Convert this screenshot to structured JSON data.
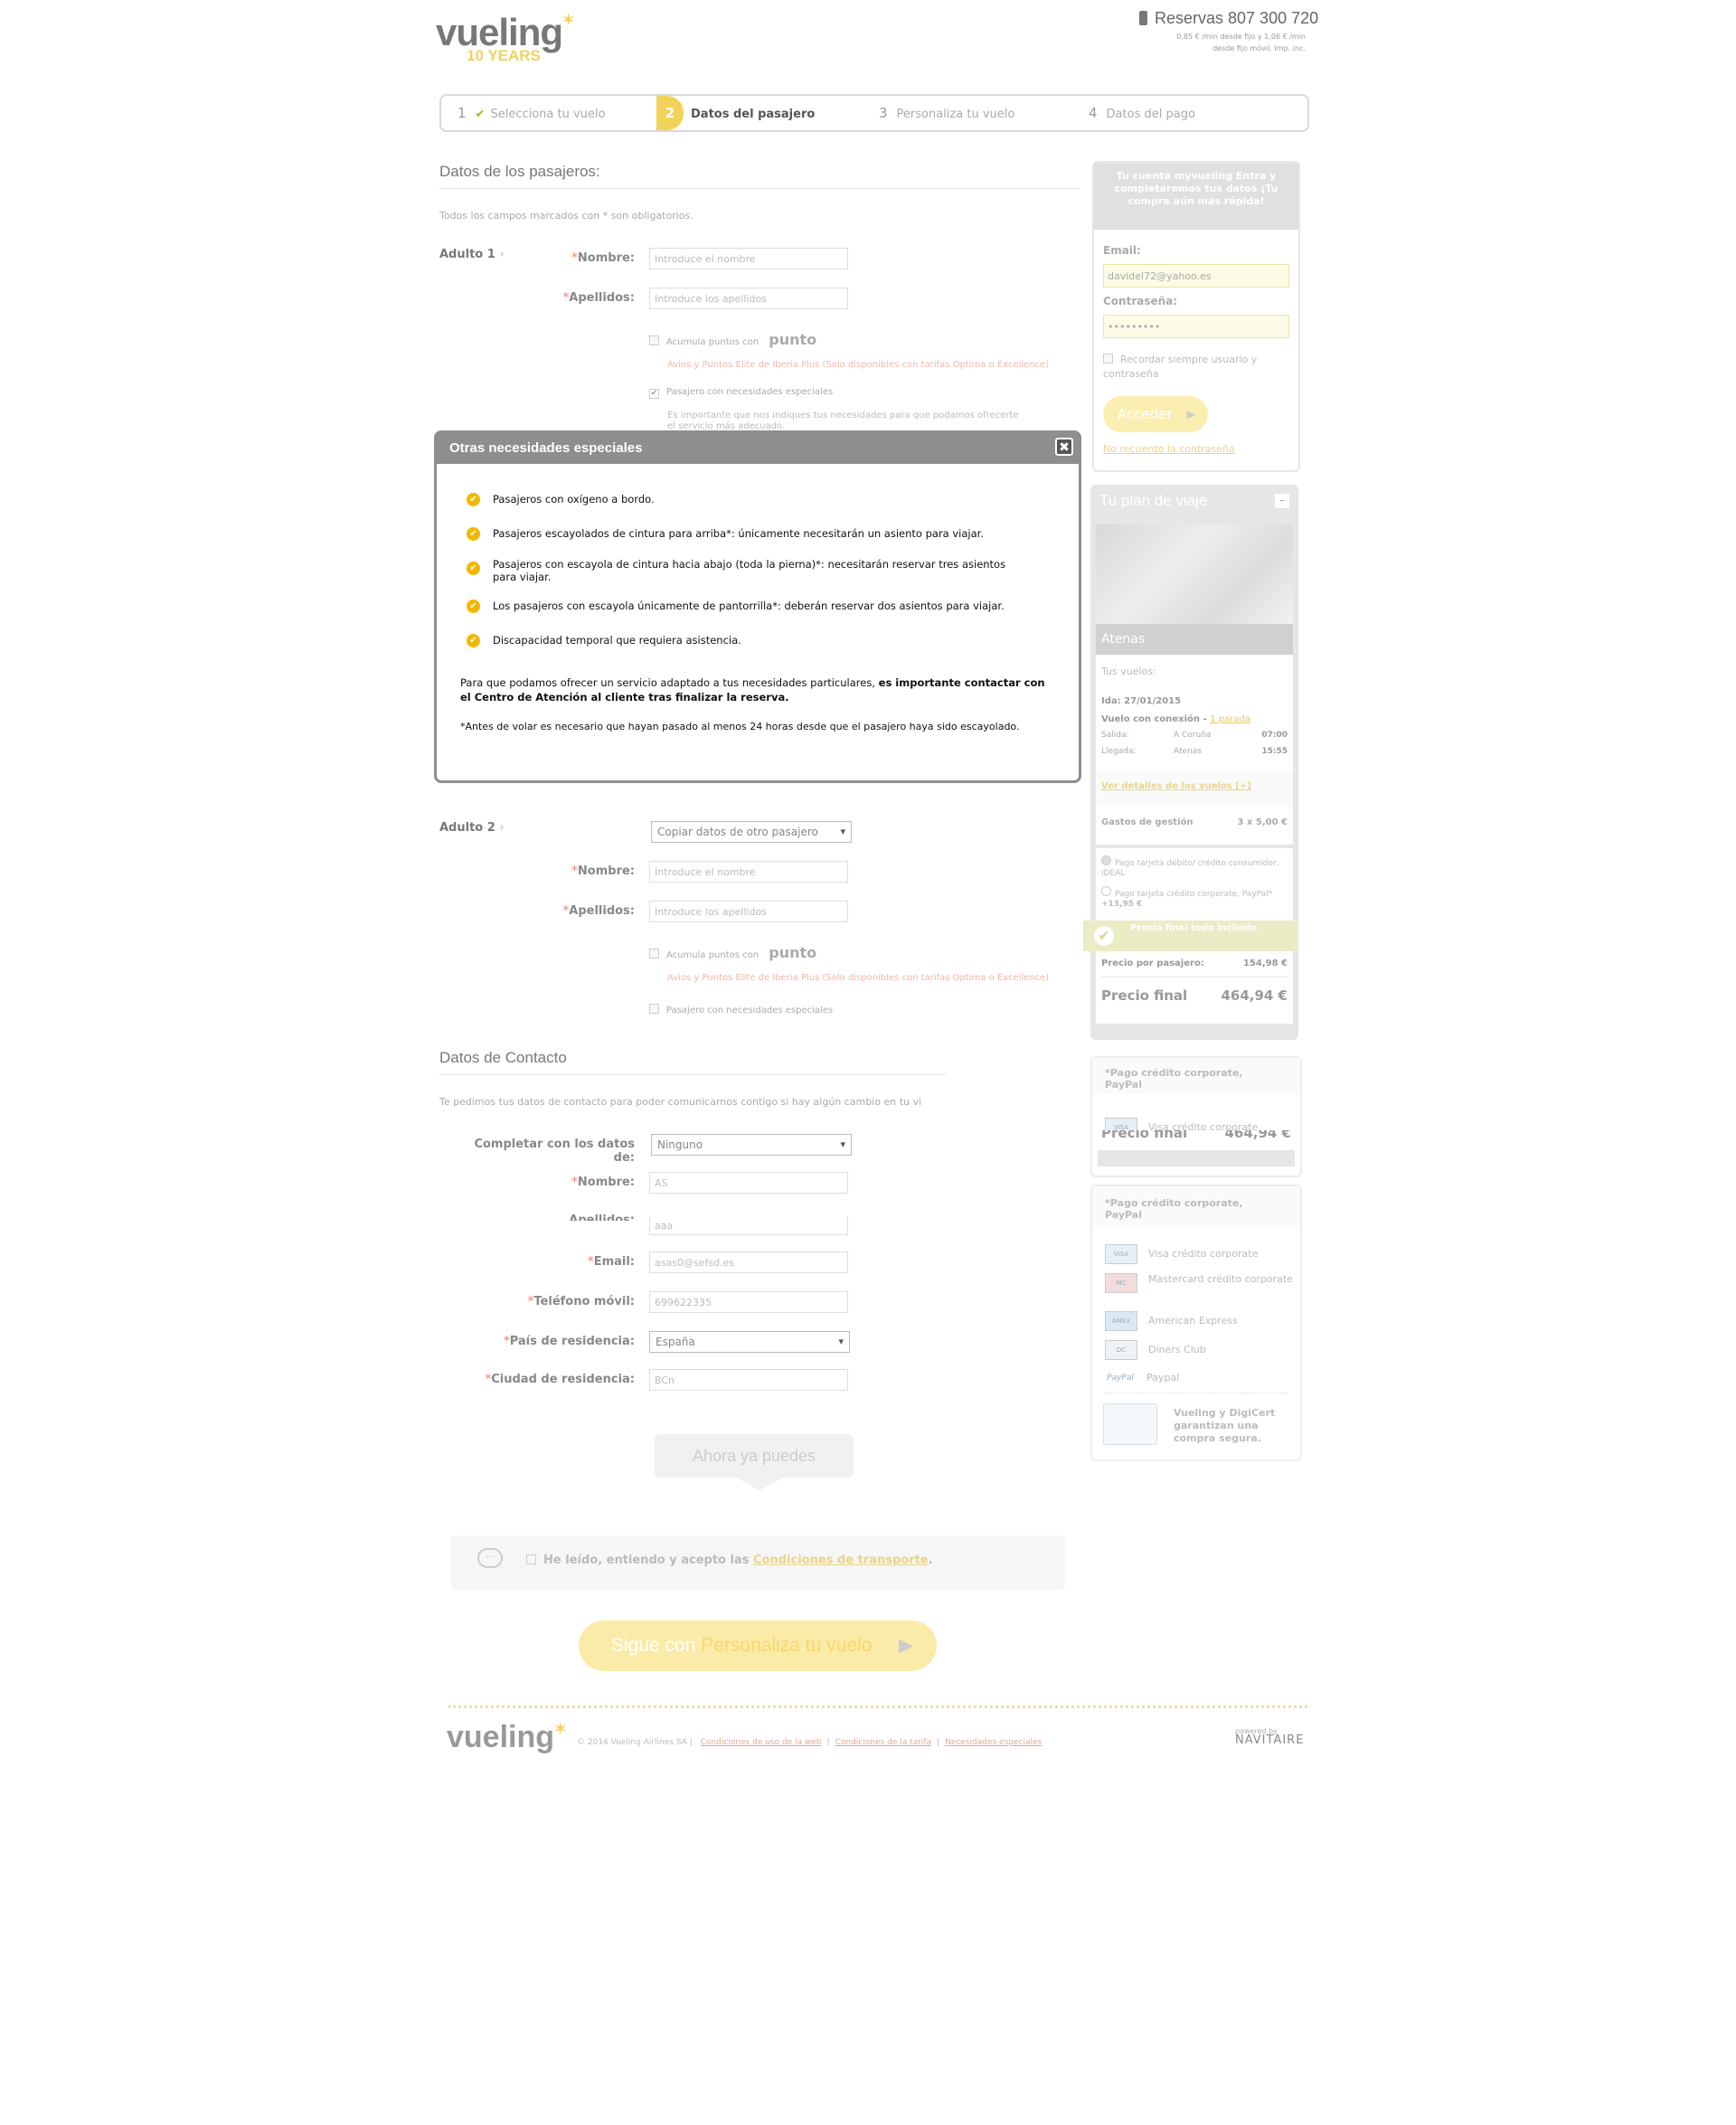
{
  "header": {
    "logo_text": "vueling",
    "logo_sub": "10 YEARS",
    "phone_label": "Reservas 807 300 720",
    "phone_note_1": "0,85 € /min desde fijo y 1,06 € /min",
    "phone_note_2": "desde fijo móvil. Imp. inc."
  },
  "steps": [
    {
      "num": "1",
      "label": "Selecciona tu vuelo",
      "state": "done"
    },
    {
      "num": "2",
      "label": "Datos del pasajero",
      "state": "active"
    },
    {
      "num": "3",
      "label": "Personaliza tu vuelo",
      "state": "todo"
    },
    {
      "num": "4",
      "label": "Datos del pago",
      "state": "todo"
    }
  ],
  "passengers": {
    "title": "Datos de los pasajeros:",
    "required_note": "Todos los campos marcados con * son obligatorios.",
    "adult1": {
      "label": "Adulto 1",
      "nombre_label": "Nombre:",
      "nombre_placeholder": "Introduce el nombre",
      "apellidos_label": "Apellidos:",
      "apellidos_placeholder": "Introduce los apellidos",
      "puntos_label": "Acumula puntos con",
      "puntos_brand": "punto",
      "iberia_note": "Avios y Puntos Elite de Iberia Plus (Solo disponibles con tarifas Optima o Excellence)",
      "necesidades_label": "Pasajero con necesidades especiales",
      "necesidades_note": "Es importante que nos indiques tus necesidades para que podamos ofrecerte el servicio más adecuado."
    },
    "adult2": {
      "label": "Adulto 2",
      "copy_select": "Copiar datos de otro pasajero",
      "nombre_label": "Nombre:",
      "nombre_placeholder": "Introduce el nombre",
      "apellidos_label": "Apellidos:",
      "apellidos_placeholder": "Introduce los apellidos",
      "puntos_label": "Acumula puntos con",
      "puntos_brand": "punto",
      "iberia_note": "Avios y Puntos Elite de Iberia Plus (Solo disponibles con tarifas Optima o Excellence)",
      "necesidades_label": "Pasajero con necesidades especiales"
    }
  },
  "contact": {
    "title": "Datos de Contacto",
    "note": "Te pedimos tus datos de contacto para poder comunicarnos contigo si hay algún cambio en tu vi",
    "completar_label": "Completar con los datos de:",
    "completar_value": "Ninguno",
    "nombre_label": "Nombre:",
    "nombre_value": "AS",
    "apellidos_label": "Apellidos:",
    "apellidos_value": "aaa",
    "email_label": "Email:",
    "email_value": "asas0@sefsd.es",
    "telefono_label": "Teléfono móvil:",
    "telefono_value": "699622335",
    "pais_label": "País de residencia:",
    "pais_value": "España",
    "ciudad_label": "Ciudad de residencia:",
    "ciudad_value": "BCn"
  },
  "ahora": "Ahora ya puedes",
  "accept": {
    "text": "He leído, entiendo y acepto las",
    "link": "Condiciones de transporte",
    "dot": "."
  },
  "continue": {
    "prefix": "Sigue con",
    "bold": "Personaliza tu vuelo"
  },
  "login": {
    "head": "Tu cuenta myvueling Entra y completaremos tus datos ¡Tu compra aún más rápida!",
    "email_label": "Email:",
    "email_value": "davidel72@yahoo.es",
    "password_label": "Contraseña:",
    "password_value": "•••••••••",
    "remember": "Recordar siempre usuario y contraseña",
    "button": "Acceder",
    "forgot": "No recuerdo la contraseña"
  },
  "plan": {
    "title": "Tu plan de viaje",
    "minimize": "–",
    "destination": "Atenas",
    "tus_vuelos": "Tus vuelos:",
    "ida": "Ida: 27/01/2015",
    "conexion": "Vuelo con conexión -",
    "parada": "1 parada",
    "salida_label": "Salida:",
    "salida_city": "A Coruña",
    "salida_time": "07:00",
    "llegada_label": "Llegada:",
    "llegada_city": "Atenas",
    "llegada_time": "15:55",
    "detalles": "Ver detalles de los vuelos [+]",
    "gastos_label": "Gastos de gestión",
    "gastos_value": "3 x 5,00 €",
    "pago1": "Pago tarjeta débito/ crédito consumidor, iDEAL",
    "pago2": "Pago tarjeta crédito corporate, PayPal*",
    "pago2_extra": "+13,95 €",
    "precio_incluido": "Precio final todo incluido",
    "precio_pasajero_label": "Precio por pasajero:",
    "precio_pasajero_value": "154,98 €",
    "precio_final_label": "Precio final",
    "precio_final_value": "464,94 €"
  },
  "card_ghost": {
    "title": "*Pago crédito corporate, PayPal",
    "item": "Visa crédito corporate",
    "cut_label": "Precio final",
    "cut_value": "464,94 €"
  },
  "cards": {
    "title": "*Pago crédito corporate, PayPal",
    "items": [
      {
        "icon": "visa-icon",
        "label": "Visa crédito corporate"
      },
      {
        "icon": "mastercard-icon",
        "label": "Mastercard crédito corporate"
      },
      {
        "icon": "amex-icon",
        "label": "American Express"
      },
      {
        "icon": "diners-icon",
        "label": "Diners Club"
      },
      {
        "icon": "paypal-icon",
        "label": "Paypal"
      }
    ],
    "secure_text": "Vueling y DigiCert garantizan una compra segura."
  },
  "modal": {
    "title": "Otras necesidades especiales",
    "items": [
      "Pasajeros con oxígeno a bordo.",
      "Pasajeros escayolados de cintura para arriba*: únicamente necesitarán un asiento para viajar.",
      "Pasajeros con escayola de cintura hacia abajo (toda la pierna)*: necesitarán reservar tres asientos para viajar.",
      "Los pasajeros con escayola únicamente de pantorrilla*: deberán reservar dos asientos para viajar.",
      "Discapacidad temporal que requiera asistencia."
    ],
    "para_normal": "Para que podamos ofrecer un servicio adaptado a tus necesidades particulares,",
    "para_bold": "es importante contactar con el Centro de Atención al cliente tras finalizar la reserva.",
    "footnote": "*Antes de volar es necesario que hayan pasado al menos 24 horas desde que el pasajero haya sido escayolado."
  },
  "footer": {
    "logo": "vueling",
    "copyright": "© 2014 Vueling Airlines SA",
    "links": [
      "Condiciones de uso de la web",
      "Condiciones de la tarifa",
      "Necesidades especiales"
    ],
    "powered": "powered by",
    "navitaire": "NAVITAIRE"
  },
  "colors": {
    "brand_yellow": "#f2d35a",
    "modal_header": "#8e8e8e",
    "bullet": "#f0b800"
  }
}
